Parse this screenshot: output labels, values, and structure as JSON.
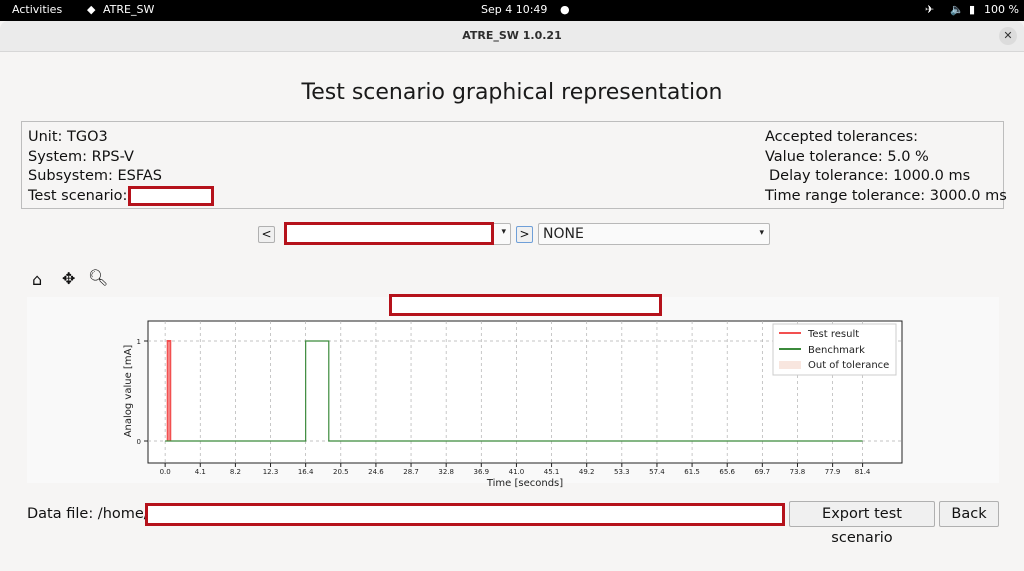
{
  "topbar": {
    "activities": "Activities",
    "app_name": "ATRE_SW",
    "datetime": "Sep 4  10:49",
    "battery": "100 %"
  },
  "window": {
    "title": "ATRE_SW 1.0.21"
  },
  "page": {
    "title": "Test scenario graphical representation"
  },
  "info": {
    "unit": "Unit: TGO3",
    "system": "System: RPS-V",
    "subsystem": "Subsystem: ESFAS",
    "test_scenario_label": "Test scenario:",
    "tolerances_header": "Accepted tolerances:",
    "value_tolerance": "Value tolerance: 5.0 %",
    "delay_tolerance": "Delay tolerance: 1000.0 ms",
    "time_range_tolerance": "Time range tolerance: 3000.0 ms"
  },
  "nav": {
    "prev": "<",
    "next": ">",
    "second_select": "NONE"
  },
  "toolbar": {
    "home": "home-icon",
    "pan": "pan-icon",
    "zoom": "zoom-icon"
  },
  "chart_data": {
    "type": "line",
    "ylabel": "Analog value [mA]",
    "xlabel": "Time [seconds]",
    "x_ticks": [
      "0.0",
      "4.1",
      "8.2",
      "12.3",
      "16.4",
      "20.5",
      "24.6",
      "28.7",
      "32.8",
      "36.9",
      "41.0",
      "45.1",
      "49.2",
      "53.3",
      "57.4",
      "61.5",
      "65.6",
      "69.7",
      "73.8",
      "77.9",
      "81.4"
    ],
    "y_ticks": [
      "0",
      "1"
    ],
    "xlim": [
      -2.0,
      86.0
    ],
    "ylim": [
      -0.22,
      1.2
    ],
    "grid": true,
    "legend_position": "top-right",
    "series": [
      {
        "name": "Test result",
        "color": "#f25050",
        "x": [
          0.3,
          0.3,
          0.6,
          0.6
        ],
        "y": [
          0,
          1,
          1,
          0
        ]
      },
      {
        "name": "Benchmark",
        "color": "#3b8a3b",
        "x": [
          0.0,
          16.4,
          16.4,
          19.1,
          19.1,
          81.4
        ],
        "y": [
          0,
          0,
          1,
          1,
          0,
          0
        ]
      }
    ],
    "legend": [
      "Test result",
      "Benchmark",
      "Out of tolerance"
    ],
    "out_of_tolerance_color": "#f8e6df"
  },
  "footer": {
    "data_file_label": "Data file: /home/",
    "export_button": "Export test scenario",
    "back_button": "Back"
  }
}
